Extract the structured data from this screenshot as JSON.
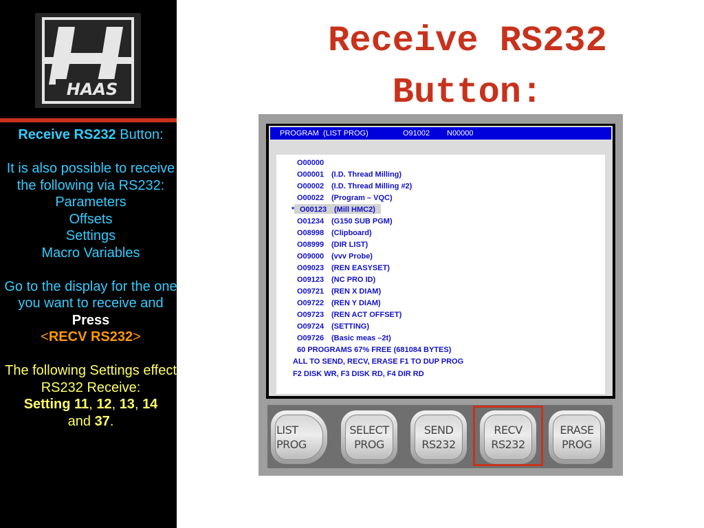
{
  "title": {
    "line1": "Receive RS232",
    "line2": "Button:"
  },
  "logo": {
    "brand": "HAAS"
  },
  "sidebar": {
    "heading_bold": "Receive RS232",
    "heading_rest": " Button:",
    "intro": "It is also possible to receive the following via RS232:",
    "items": [
      "Parameters",
      "Offsets",
      "Settings",
      "Macro Variables"
    ],
    "goto": "Go to the display for the one you want to receive and",
    "press": "Press",
    "key_open": "<",
    "key_name": "RECV RS232",
    "key_close": ">",
    "settings_intro": "The following Settings effect RS232 Receive:",
    "setting_label": "Setting",
    "setting_nums": [
      "11",
      "12",
      "13",
      "14"
    ],
    "and_word": "and",
    "last_num": "37",
    "sep": ",",
    "period": "."
  },
  "screen": {
    "header_mode": "PROGRAM  (LIST PROG)",
    "header_prog": "O91002",
    "header_seq": "N00000",
    "programs": [
      {
        "number": "O00000",
        "name": ""
      },
      {
        "number": "O00001",
        "name": "(I.D. Thread Milling)"
      },
      {
        "number": "O00002",
        "name": "(I.D. Thread Milling #2)"
      },
      {
        "number": "O00022",
        "name": "(Program – VQC)"
      },
      {
        "number": "O00123",
        "name": "(Mill HMC2)",
        "marker": "*",
        "selected": true
      },
      {
        "number": "O01234",
        "name": "(G150 SUB PGM)"
      },
      {
        "number": "O08998",
        "name": "(Clipboard)"
      },
      {
        "number": "O08999",
        "name": "(DIR LIST)"
      },
      {
        "number": "O09000",
        "name": "(vvv Probe)"
      },
      {
        "number": "O09023",
        "name": "(REN EASYSET)"
      },
      {
        "number": "O09123",
        "name": "(NC PRO ID)"
      },
      {
        "number": "O09721",
        "name": "(REN X DIAM)"
      },
      {
        "number": "O09722",
        "name": "(REN Y DIAM)"
      },
      {
        "number": "O09723",
        "name": "(REN ACT OFFSET)"
      },
      {
        "number": "O09724",
        "name": "(SETTING)"
      },
      {
        "number": "O09726",
        "name": "(Basic meas –2t)"
      }
    ],
    "free_line": "60 PROGRAMS 67% FREE (681084 BYTES)",
    "help_line1": "ALL TO SEND, RECV, ERASE F1 TO DUP PROG",
    "help_line2": "F2 DISK WR, F3 DISK RD, F4 DIR RD"
  },
  "softkeys": [
    {
      "line1": "LIST",
      "line2": "PROG"
    },
    {
      "line1": "SELECT",
      "line2": "PROG"
    },
    {
      "line1": "SEND",
      "line2": "RS232"
    },
    {
      "line1": "RECV",
      "line2": "RS232",
      "highlighted": true
    },
    {
      "line1": "ERASE",
      "line2": "PROG"
    }
  ],
  "colors": {
    "accent_red": "#c8321c",
    "screen_blue": "#0000dd",
    "list_text_blue": "#1010c8",
    "sidebar_yellow": "#ffff66",
    "sidebar_cyan": "#33ccff",
    "sidebar_orange": "#ff9900"
  }
}
